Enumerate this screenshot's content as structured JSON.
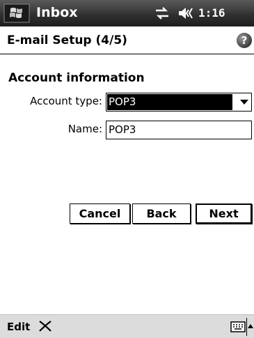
{
  "titlebar": {
    "app_title": "Inbox",
    "clock": "1:16"
  },
  "header": {
    "page_title": "E-mail Setup (4/5)",
    "help_glyph": "?"
  },
  "section": {
    "title": "Account information"
  },
  "fields": {
    "account_type_label": "Account type:",
    "account_type_value": "POP3",
    "name_label": "Name:",
    "name_value": "POP3"
  },
  "buttons": {
    "cancel": "Cancel",
    "back": "Back",
    "next": "Next"
  },
  "menubar": {
    "edit": "Edit"
  },
  "icons": {
    "start": "windows-flag-icon",
    "connectivity": "connectivity-arrows-icon",
    "volume": "speaker-icon",
    "help": "help-icon",
    "delete": "delete-x-icon",
    "keyboard": "keyboard-icon"
  }
}
